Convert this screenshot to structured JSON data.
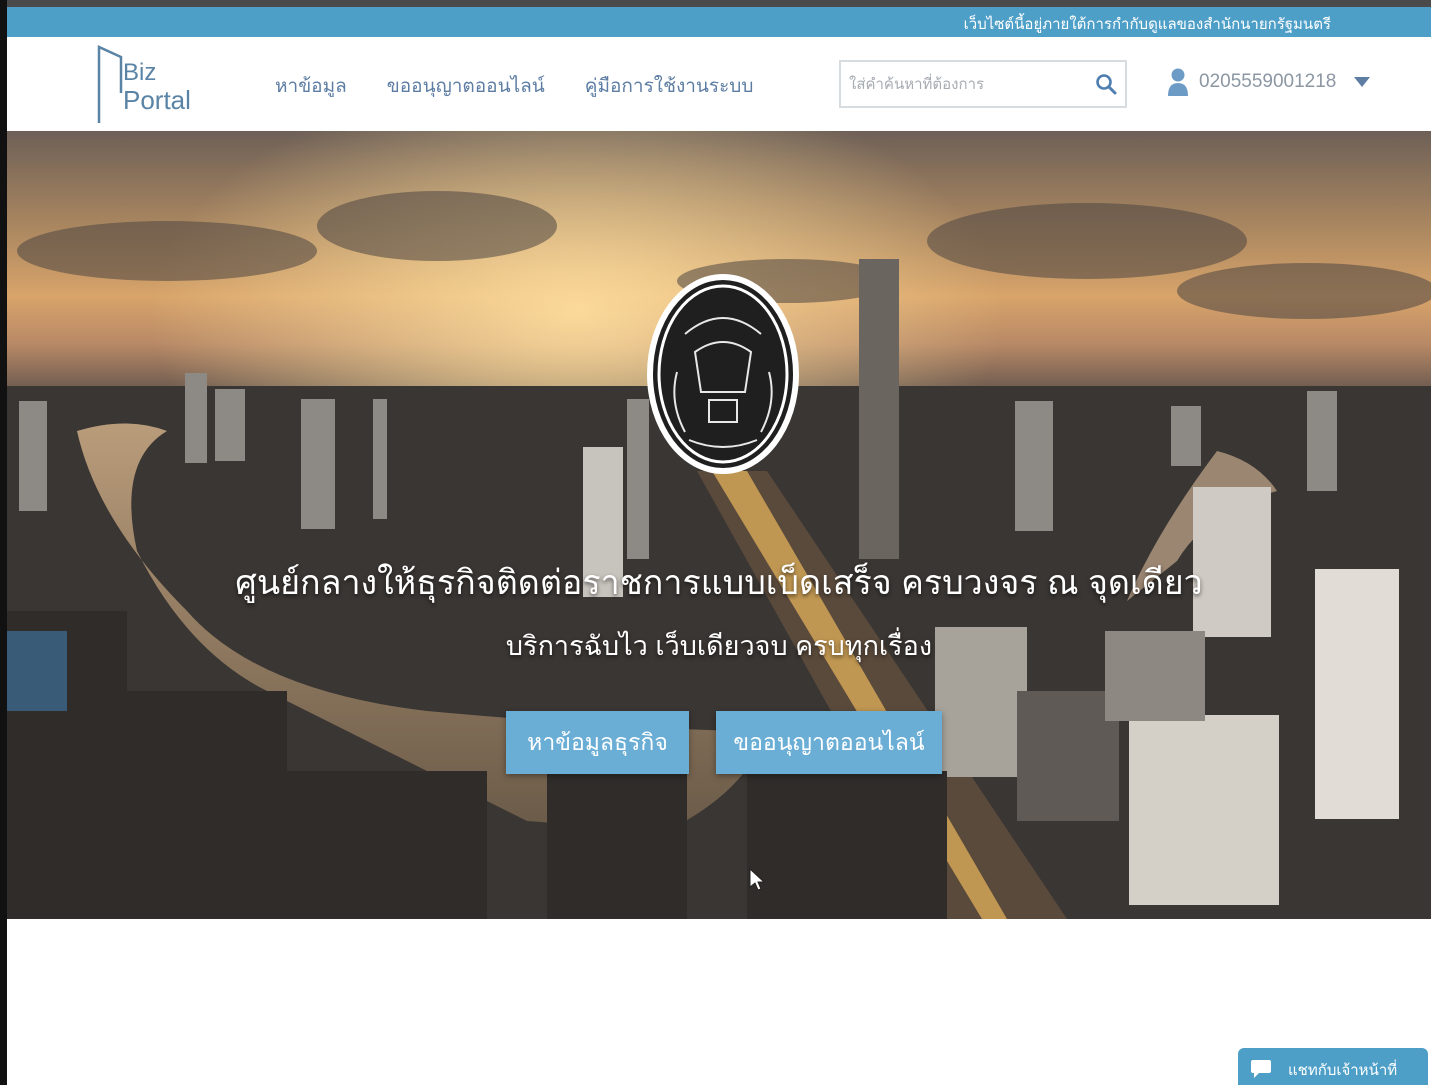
{
  "notice_bar": {
    "text": "เว็บไซต์นี้อยู่ภายใต้การกำกับดูแลของสำนักนายกรัฐมนตรี"
  },
  "logo": {
    "line1": "Biz",
    "line2": "Portal"
  },
  "nav": {
    "items": [
      {
        "label": "หาข้อมูล"
      },
      {
        "label": "ขออนุญาตออนไลน์"
      },
      {
        "label": "คู่มือการใช้งานระบบ"
      }
    ]
  },
  "search": {
    "placeholder": "ใส่คำค้นหาที่ต้องการ",
    "value": "",
    "icon": "search-icon"
  },
  "user": {
    "id": "0205559001218",
    "icon": "user-icon",
    "menu_icon": "caret-down-icon"
  },
  "hero": {
    "title": "ศูนย์กลางให้ธุรกิจติดต่อราชการแบบเบ็ดเสร็จ ครบวงจร ณ จุดเดียว",
    "subtitle": "บริการฉับไว เว็บเดียวจบ ครบทุกเรื่อง",
    "buttons": {
      "search_business": "หาข้อมูลธุรกิจ",
      "license_online": "ขออนุญาตออนไลน์"
    }
  },
  "chat": {
    "label": "แชทกับเจ้าหน้าที่",
    "icon": "chat-bubble-icon"
  },
  "colors": {
    "accent": "#4e9fc8",
    "button": "#6aaed6",
    "nav_text": "#5d7da3"
  }
}
